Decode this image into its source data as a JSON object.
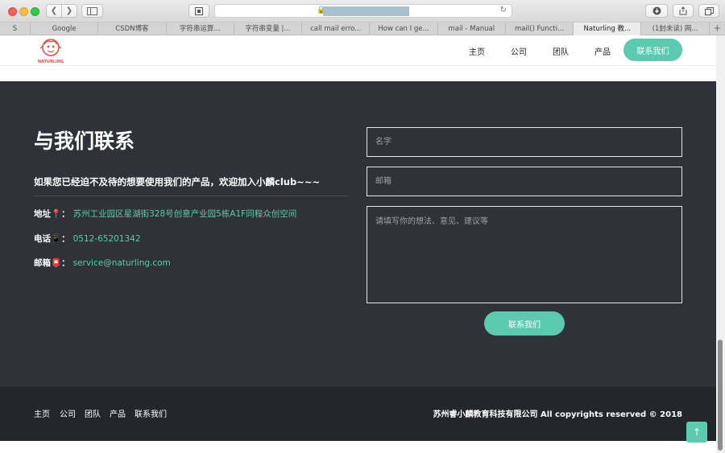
{
  "browser": {
    "url_masked": "████████████",
    "icons": {
      "back": "chevron-left-icon",
      "forward": "chevron-right-icon",
      "sidebar": "sidebar-icon",
      "reader": "reader-icon",
      "lock": "lock-icon",
      "reload": "reload-icon",
      "download": "download-icon",
      "share": "share-icon",
      "tabs": "tabs-icon"
    },
    "tabs": [
      {
        "label": "S"
      },
      {
        "label": "Google"
      },
      {
        "label": "CSDN博客"
      },
      {
        "label": "字符串运算..."
      },
      {
        "label": "字符串变量 |..."
      },
      {
        "label": "call mail erro..."
      },
      {
        "label": "How can I ge..."
      },
      {
        "label": "mail - Manual"
      },
      {
        "label": "mail() Functi..."
      },
      {
        "label": "Naturling 教..."
      },
      {
        "label": "(1封未读) 网..."
      }
    ],
    "new_tab_label": "+"
  },
  "header": {
    "logo_text": "NATURLING",
    "nav": {
      "home": "主页",
      "company": "公司",
      "team": "团队",
      "product": "产品",
      "contact": "联系我们"
    }
  },
  "contact": {
    "title": "与我们联系",
    "intro_prefix": "如果您已经迫不及待的想要使用我们的产品，欢迎加入",
    "intro_highlight": "小麟club~~~",
    "address_label": "地址📍：",
    "address_value": "苏州工业园区星湖街328号创意产业园5栋A1F同程众创空间",
    "phone_label": "电话📱：",
    "phone_value": "0512-65201342",
    "email_label": "邮箱📮：",
    "email_value": "service@naturling.com",
    "form": {
      "name_placeholder": "名字",
      "email_placeholder": "邮箱",
      "message_placeholder": "请填写你的想法、意见、建议等",
      "submit_label": "联系我们"
    }
  },
  "footer": {
    "links": {
      "home": "主页",
      "company": "公司",
      "team": "团队",
      "product": "产品",
      "contact": "联系我们"
    },
    "copyright": "苏州睿小麟教育科技有限公司 All copyrights reserved © 2018"
  },
  "colors": {
    "accent": "#5ccaae",
    "section_bg": "#2f3238",
    "footer_bg": "#23262b"
  }
}
